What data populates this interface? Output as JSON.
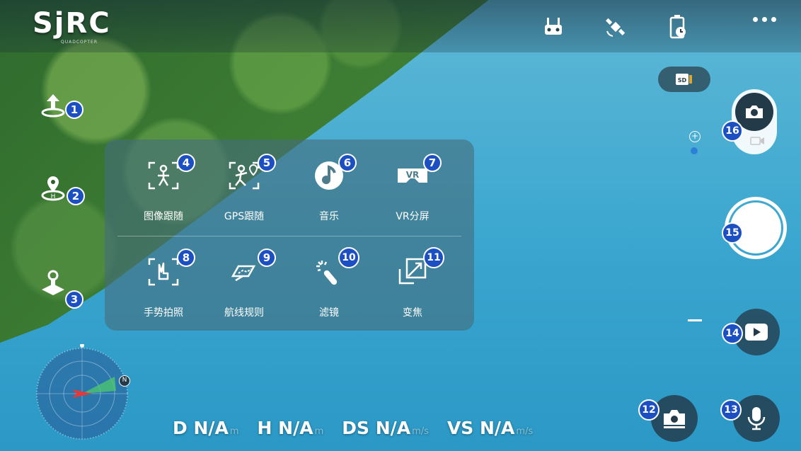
{
  "app": {
    "logo_text": "SjRC",
    "logo_subtext": "QUADCOPTER"
  },
  "topbar": {
    "icons": [
      "remote-controller-icon",
      "satellite-gps-icon",
      "battery-timer-icon",
      "more-options-icon"
    ]
  },
  "left_rail": [
    {
      "name": "takeoff",
      "badge": "1",
      "icon": "takeoff-icon"
    },
    {
      "name": "return-home",
      "badge": "2",
      "icon": "return-home-icon"
    },
    {
      "name": "joystick",
      "badge": "3",
      "icon": "joystick-icon"
    }
  ],
  "menu": {
    "items": [
      {
        "label": "图像跟随",
        "badge": "4",
        "icon": "image-follow-icon"
      },
      {
        "label": "GPS跟随",
        "badge": "5",
        "icon": "gps-follow-icon"
      },
      {
        "label": "音乐",
        "badge": "6",
        "icon": "music-icon"
      },
      {
        "label": "VR分屏",
        "badge": "7",
        "icon": "vr-split-icon"
      },
      {
        "label": "手势拍照",
        "badge": "8",
        "icon": "gesture-photo-icon"
      },
      {
        "label": "航线规则",
        "badge": "9",
        "icon": "route-plan-icon"
      },
      {
        "label": "滤镜",
        "badge": "10",
        "icon": "filter-wand-icon"
      },
      {
        "label": "变焦",
        "badge": "11",
        "icon": "zoom-icon"
      }
    ]
  },
  "right": {
    "sd_label": "SD",
    "badges": {
      "mode_toggle": "16",
      "shutter": "15",
      "playback": "14",
      "mic": "13",
      "photo": "12"
    }
  },
  "telemetry": [
    {
      "label": "D N/A",
      "unit": "m"
    },
    {
      "label": "H N/A",
      "unit": "m"
    },
    {
      "label": "DS N/A",
      "unit": "m/s"
    },
    {
      "label": "VS N/A",
      "unit": "m/s"
    }
  ],
  "compass": {
    "north_label": "N"
  },
  "colors": {
    "badge": "#1c4fc2",
    "water": "#3aa6cf",
    "forest": "#3f7f34",
    "panel": "rgba(70,110,125,0.62)"
  }
}
